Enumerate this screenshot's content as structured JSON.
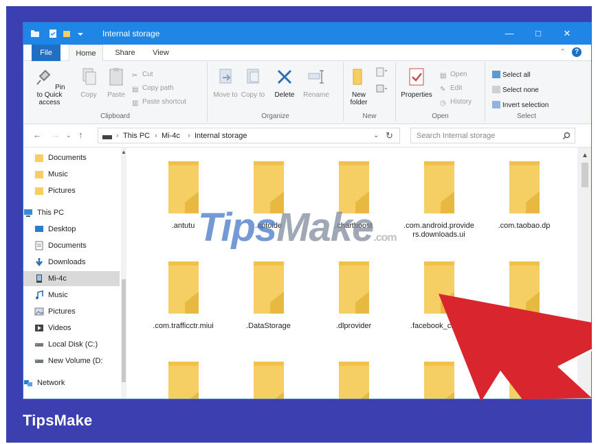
{
  "brand": "TipsMake",
  "window": {
    "title": "Internal storage"
  },
  "tabs": {
    "file": "File",
    "home": "Home",
    "share": "Share",
    "view": "View"
  },
  "ribbon": {
    "clipboard": {
      "label": "Clipboard",
      "pin": "Pin to Quick access",
      "copy": "Copy",
      "paste": "Paste",
      "cut": "Cut",
      "copy_path": "Copy path",
      "paste_shortcut": "Paste shortcut"
    },
    "organize": {
      "label": "Organize",
      "move_to": "Move to",
      "copy_to": "Copy to",
      "delete": "Delete",
      "rename": "Rename"
    },
    "new": {
      "label": "New",
      "new_folder": "New folder"
    },
    "open": {
      "label": "Open",
      "properties": "Properties",
      "open": "Open",
      "edit": "Edit",
      "history": "History"
    },
    "select": {
      "label": "Select",
      "select_all": "Select all",
      "select_none": "Select none",
      "invert": "Invert selection"
    }
  },
  "address": {
    "crumbs": [
      "This PC",
      "Mi-4c",
      "Internal storage"
    ],
    "search_placeholder": "Search Internal storage"
  },
  "nav": {
    "items": [
      "Documents",
      "Music",
      "Pictures",
      "This PC",
      "Desktop",
      "Documents",
      "Downloads",
      "Mi-4c",
      "Music",
      "Pictures",
      "Videos",
      "Local Disk (C:)",
      "New Volume (D:",
      "Network"
    ],
    "selected": "Mi-4c"
  },
  "folders": [
    ".antutu",
    ".aptoide",
    ".chartboost",
    ".com.android.providers.downloads.ui",
    ".com.taobao.dp",
    ".com.trafficctr.miui",
    ".DataStorage",
    ".dlprovider",
    ".facebook_cache",
    "",
    "",
    "",
    "",
    "",
    ""
  ],
  "watermark": {
    "a": "Tips",
    "b": "Make",
    "c": ".com"
  },
  "colors": {
    "frame": "#3b3fb0",
    "titlebar": "#1f86e6",
    "folder": "#f5cf63",
    "arrow": "#d9262e"
  }
}
